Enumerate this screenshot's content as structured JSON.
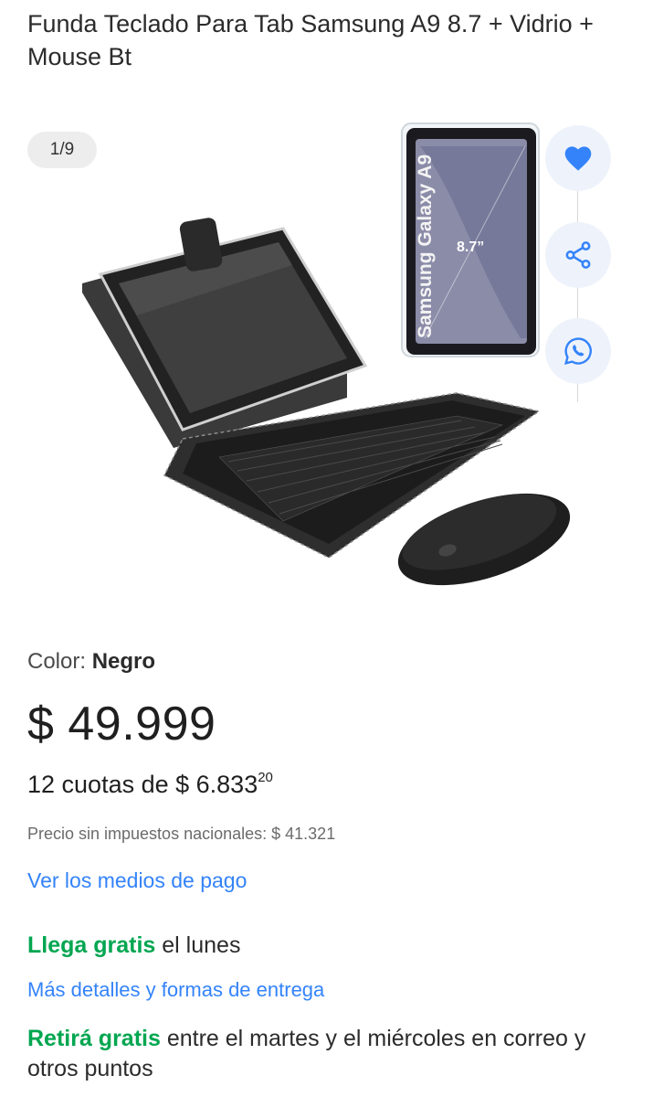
{
  "product": {
    "title": "Funda Teclado Para Tab Samsung A9 8.7  + Vidrio + Mouse Bt"
  },
  "gallery": {
    "counter": "1/9",
    "tablet_brand_text": "Samsung Galaxy A9",
    "tablet_size_text": "8.7”",
    "actions": [
      "heart-icon",
      "share-icon",
      "whatsapp-icon"
    ]
  },
  "variant": {
    "label": "Color: ",
    "value": "Negro"
  },
  "pricing": {
    "price": "$ 49.999",
    "installments_prefix": "12 cuotas de ",
    "installment_amount": "$ 6.833",
    "installment_cents": "20",
    "tax_note": "Precio sin impuestos nacionales: $ 41.321",
    "payment_link": "Ver los medios de pago"
  },
  "shipping": {
    "arrive_highlight": "Llega gratis",
    "arrive_rest": " el lunes",
    "details_link": "Más detalles y formas de entrega",
    "pickup_highlight": "Retirá gratis",
    "pickup_rest": " entre el martes y el miércoles en correo y otros puntos"
  },
  "colors": {
    "link": "#3483fa",
    "free_shipping": "#00a650",
    "action_icon": "#3483fa"
  }
}
